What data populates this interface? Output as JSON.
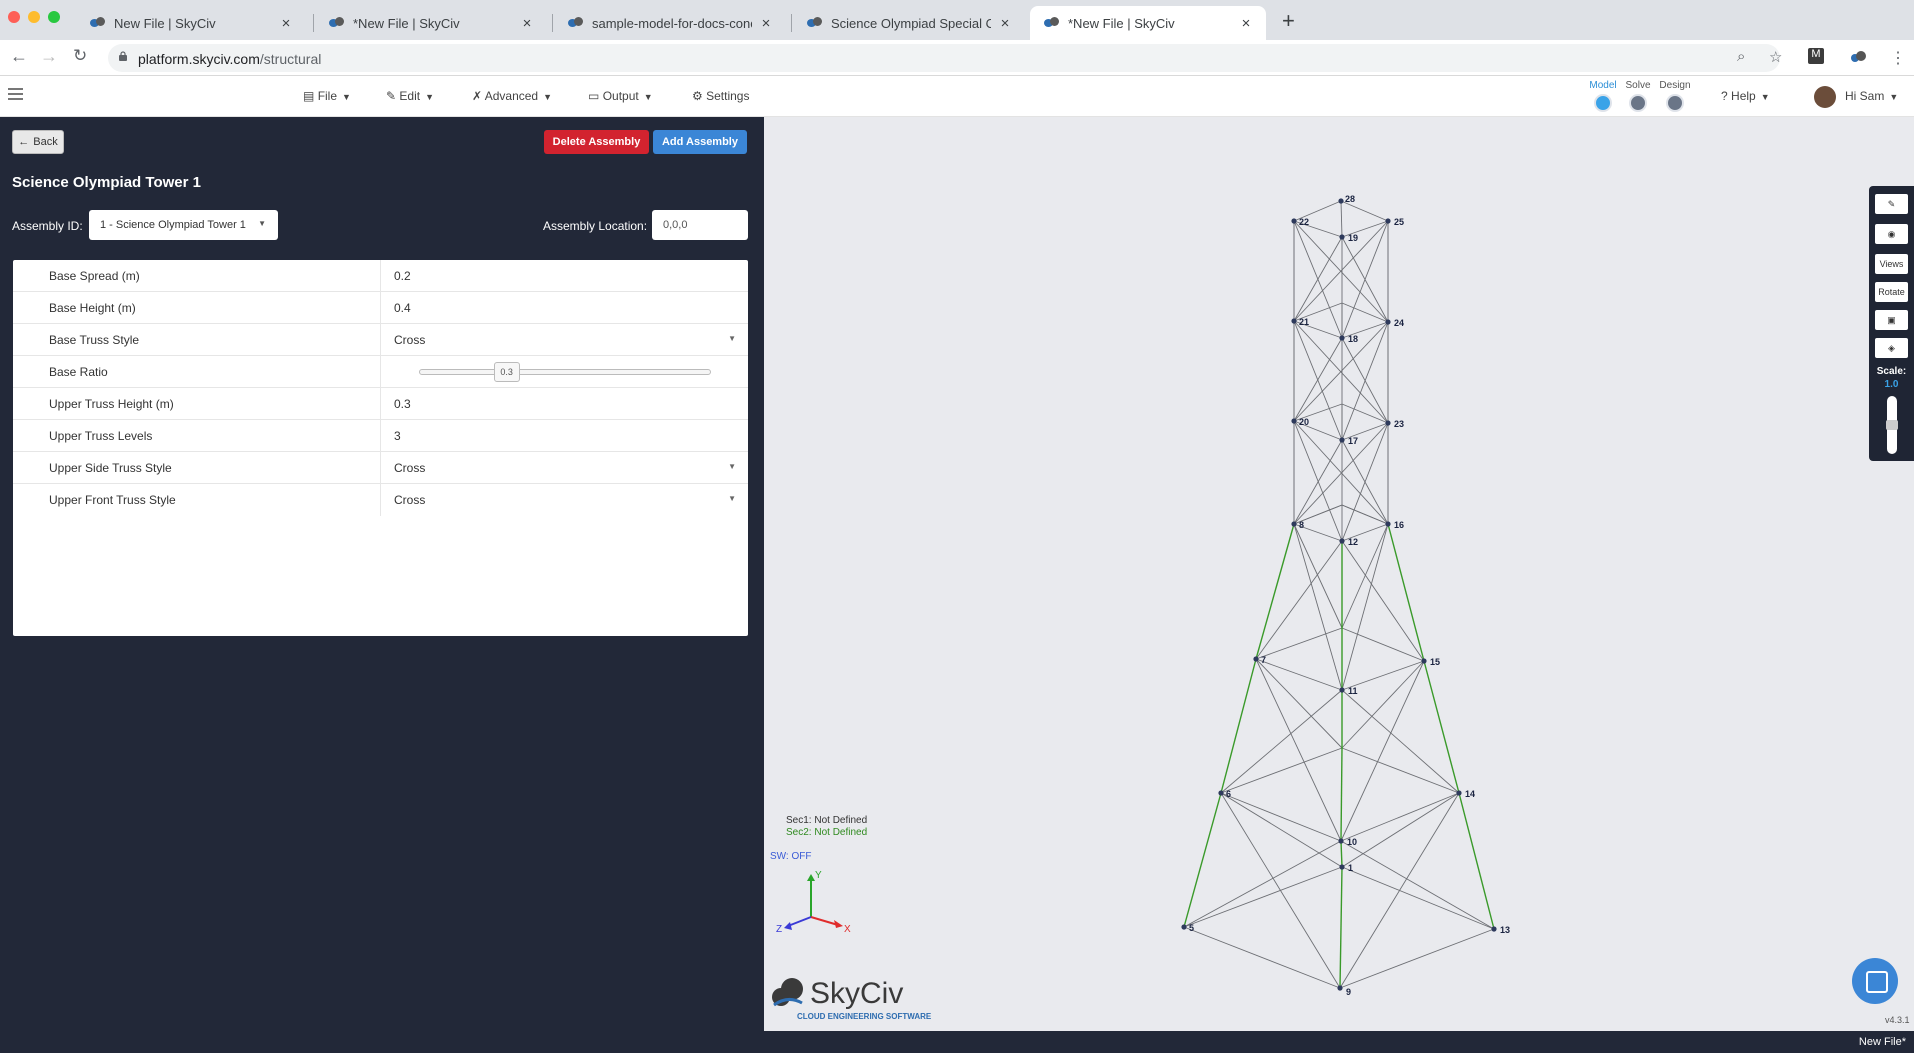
{
  "browser": {
    "tabs": [
      {
        "title": "New File | SkyCiv"
      },
      {
        "title": "*New File | SkyCiv"
      },
      {
        "title": "sample-model-for-docs-concrete"
      },
      {
        "title": "Science Olympiad Special Offer"
      },
      {
        "title": "*New File | SkyCiv"
      }
    ],
    "url_host": "platform.skyciv.com",
    "url_path": "/structural"
  },
  "toolbar": {
    "menu": [
      {
        "label": "File"
      },
      {
        "label": "Edit"
      },
      {
        "label": "Advanced"
      },
      {
        "label": "Output"
      },
      {
        "label": "Settings"
      }
    ],
    "modes": [
      {
        "label": "Model"
      },
      {
        "label": "Solve"
      },
      {
        "label": "Design"
      }
    ],
    "help": "Help",
    "user": "Hi Sam"
  },
  "panel": {
    "back": "Back",
    "delete_assembly": "Delete Assembly",
    "add_assembly": "Add Assembly",
    "title": "Science Olympiad Tower 1",
    "assembly_id_label": "Assembly ID:",
    "assembly_id_value": "1 - Science Olympiad Tower 1",
    "assembly_location_label": "Assembly Location:",
    "assembly_location_value": "0,0,0",
    "rows": [
      {
        "label": "Base Spread (m)",
        "value": "0.2"
      },
      {
        "label": "Base Height (m)",
        "value": "0.4"
      },
      {
        "label": "Base Truss Style",
        "value": "Cross"
      },
      {
        "label": "Base Ratio",
        "value": "0.3"
      },
      {
        "label": "Upper Truss Height (m)",
        "value": "0.3"
      },
      {
        "label": "Upper Truss Levels",
        "value": "3"
      },
      {
        "label": "Upper Side Truss Style",
        "value": "Cross"
      },
      {
        "label": "Upper Front Truss Style",
        "value": "Cross"
      }
    ],
    "base_ratio_fraction": 0.3
  },
  "canvas": {
    "sec1": "Sec1: Not Defined",
    "sec2": "Sec2: Not Defined",
    "sw": "SW: OFF",
    "axes": {
      "x": "X",
      "y": "Y",
      "z": "Z"
    },
    "logo": "SkyCiv",
    "logo_tag": "CLOUD ENGINEERING SOFTWARE",
    "version": "v4.3.1",
    "status": "New File*",
    "tools": [
      {
        "label": "Views"
      },
      {
        "label": "Rotate"
      }
    ],
    "scale_label": "Scale:",
    "scale_value": "1.0",
    "colors": {
      "green": "#3a9a2a",
      "member": "#6d6f74",
      "node": "#2e3a5c"
    },
    "nodes": [
      {
        "id": "1",
        "side": "center-low"
      },
      {
        "id": "5",
        "side": "left-base"
      },
      {
        "id": "9",
        "side": "bottom"
      },
      {
        "id": "13",
        "side": "right-base"
      },
      {
        "id": "6",
        "side": "left"
      },
      {
        "id": "10",
        "side": "center"
      },
      {
        "id": "14",
        "side": "right"
      },
      {
        "id": "7",
        "side": "left"
      },
      {
        "id": "11",
        "side": "center"
      },
      {
        "id": "15",
        "side": "right"
      },
      {
        "id": "8",
        "side": "left"
      },
      {
        "id": "12",
        "side": "center"
      },
      {
        "id": "16",
        "side": "right"
      },
      {
        "id": "20",
        "side": "left"
      },
      {
        "id": "17",
        "side": "center"
      },
      {
        "id": "23",
        "side": "right"
      },
      {
        "id": "21",
        "side": "left"
      },
      {
        "id": "18",
        "side": "center"
      },
      {
        "id": "24",
        "side": "right"
      },
      {
        "id": "22",
        "side": "left"
      },
      {
        "id": "19",
        "side": "center"
      },
      {
        "id": "25",
        "side": "right"
      },
      {
        "id": "28",
        "side": "top"
      }
    ]
  }
}
